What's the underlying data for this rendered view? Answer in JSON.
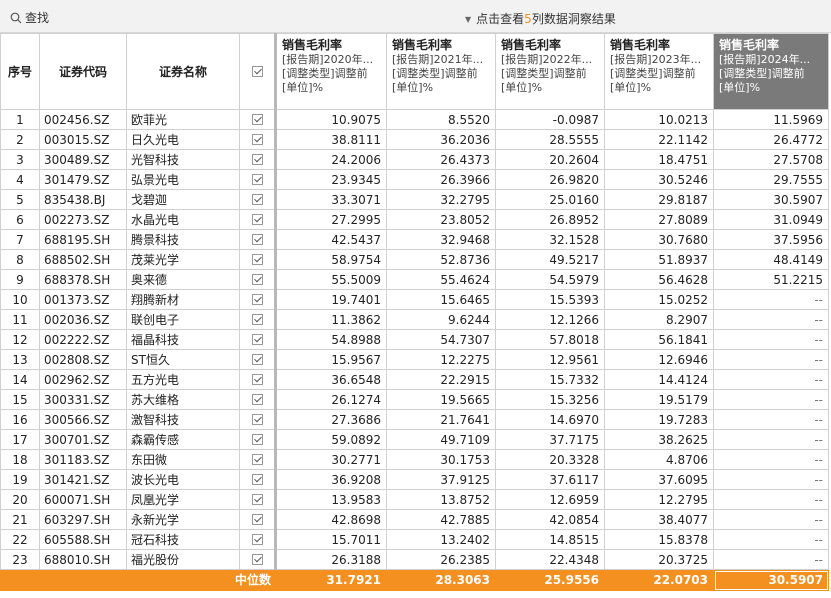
{
  "toolbar": {
    "search_label": "查找",
    "hint_prefix": "点击查看",
    "hint_count": "5",
    "hint_suffix": "列数据洞察结果"
  },
  "columns": {
    "index": "序号",
    "code": "证券代码",
    "name": "证券名称",
    "metrics": [
      {
        "title": "销售毛利率",
        "line1": "[报告期]2020年...",
        "line2": "[调整类型]调整前",
        "line3": "[单位]%"
      },
      {
        "title": "销售毛利率",
        "line1": "[报告期]2021年...",
        "line2": "[调整类型]调整前",
        "line3": "[单位]%"
      },
      {
        "title": "销售毛利率",
        "line1": "[报告期]2022年...",
        "line2": "[调整类型]调整前",
        "line3": "[单位]%"
      },
      {
        "title": "销售毛利率",
        "line1": "[报告期]2023年...",
        "line2": "[调整类型]调整前",
        "line3": "[单位]%"
      },
      {
        "title": "销售毛利率",
        "line1": "[报告期]2024年...",
        "line2": "[调整类型]调整前",
        "line3": "[单位]%"
      }
    ]
  },
  "rows": [
    {
      "idx": "1",
      "code": "002456.SZ",
      "name": "欧菲光",
      "v": [
        "10.9075",
        "8.5520",
        "-0.0987",
        "10.0213",
        "11.5969"
      ]
    },
    {
      "idx": "2",
      "code": "003015.SZ",
      "name": "日久光电",
      "v": [
        "38.8111",
        "36.2036",
        "28.5555",
        "22.1142",
        "26.4772"
      ]
    },
    {
      "idx": "3",
      "code": "300489.SZ",
      "name": "光智科技",
      "v": [
        "24.2006",
        "26.4373",
        "20.2604",
        "18.4751",
        "27.5708"
      ]
    },
    {
      "idx": "4",
      "code": "301479.SZ",
      "name": "弘景光电",
      "v": [
        "23.9345",
        "26.3966",
        "26.9820",
        "30.5246",
        "29.7555"
      ]
    },
    {
      "idx": "5",
      "code": "835438.BJ",
      "name": "戈碧迦",
      "v": [
        "33.3071",
        "32.2795",
        "25.0160",
        "29.8187",
        "30.5907"
      ]
    },
    {
      "idx": "6",
      "code": "002273.SZ",
      "name": "水晶光电",
      "v": [
        "27.2995",
        "23.8052",
        "26.8952",
        "27.8089",
        "31.0949"
      ]
    },
    {
      "idx": "7",
      "code": "688195.SH",
      "name": "腾景科技",
      "v": [
        "42.5437",
        "32.9468",
        "32.1528",
        "30.7680",
        "37.5956"
      ]
    },
    {
      "idx": "8",
      "code": "688502.SH",
      "name": "茂莱光学",
      "v": [
        "58.9754",
        "52.8736",
        "49.5217",
        "51.8937",
        "48.4149"
      ]
    },
    {
      "idx": "9",
      "code": "688378.SH",
      "name": "奥来德",
      "v": [
        "55.5009",
        "55.4624",
        "54.5979",
        "56.4628",
        "51.2215"
      ]
    },
    {
      "idx": "10",
      "code": "001373.SZ",
      "name": "翔腾新材",
      "v": [
        "19.7401",
        "15.6465",
        "15.5393",
        "15.0252",
        "--"
      ]
    },
    {
      "idx": "11",
      "code": "002036.SZ",
      "name": "联创电子",
      "v": [
        "11.3862",
        "9.6244",
        "12.1266",
        "8.2907",
        "--"
      ]
    },
    {
      "idx": "12",
      "code": "002222.SZ",
      "name": "福晶科技",
      "v": [
        "54.8988",
        "54.7307",
        "57.8018",
        "56.1841",
        "--"
      ]
    },
    {
      "idx": "13",
      "code": "002808.SZ",
      "name": "ST恒久",
      "v": [
        "15.9567",
        "12.2275",
        "12.9561",
        "12.6946",
        "--"
      ]
    },
    {
      "idx": "14",
      "code": "002962.SZ",
      "name": "五方光电",
      "v": [
        "36.6548",
        "22.2915",
        "15.7332",
        "14.4124",
        "--"
      ]
    },
    {
      "idx": "15",
      "code": "300331.SZ",
      "name": "苏大维格",
      "v": [
        "26.1274",
        "19.5665",
        "15.3256",
        "19.5179",
        "--"
      ]
    },
    {
      "idx": "16",
      "code": "300566.SZ",
      "name": "激智科技",
      "v": [
        "27.3686",
        "21.7641",
        "14.6970",
        "19.7283",
        "--"
      ]
    },
    {
      "idx": "17",
      "code": "300701.SZ",
      "name": "森霸传感",
      "v": [
        "59.0892",
        "49.7109",
        "37.7175",
        "38.2625",
        "--"
      ]
    },
    {
      "idx": "18",
      "code": "301183.SZ",
      "name": "东田微",
      "v": [
        "30.2771",
        "30.1753",
        "20.3328",
        "4.8706",
        "--"
      ]
    },
    {
      "idx": "19",
      "code": "301421.SZ",
      "name": "波长光电",
      "v": [
        "36.9208",
        "37.9125",
        "37.6117",
        "37.6095",
        "--"
      ]
    },
    {
      "idx": "20",
      "code": "600071.SH",
      "name": "凤凰光学",
      "v": [
        "13.9583",
        "13.8752",
        "12.6959",
        "12.2795",
        "--"
      ]
    },
    {
      "idx": "21",
      "code": "603297.SH",
      "name": "永新光学",
      "v": [
        "42.8698",
        "42.7885",
        "42.0854",
        "38.4077",
        "--"
      ]
    },
    {
      "idx": "22",
      "code": "605588.SH",
      "name": "冠石科技",
      "v": [
        "15.7011",
        "13.2402",
        "14.8515",
        "15.8378",
        "--"
      ]
    },
    {
      "idx": "23",
      "code": "688010.SH",
      "name": "福光股份",
      "v": [
        "26.3188",
        "26.2385",
        "22.4348",
        "20.3725",
        "--"
      ]
    }
  ],
  "median": {
    "label": "中位数",
    "v": [
      "31.7921",
      "28.3063",
      "25.9556",
      "22.0703",
      "30.5907"
    ]
  },
  "colors": {
    "accent_orange": "#f39020",
    "active_header_bg": "#7a7a7a",
    "grid_line": "#d0d0d0"
  }
}
